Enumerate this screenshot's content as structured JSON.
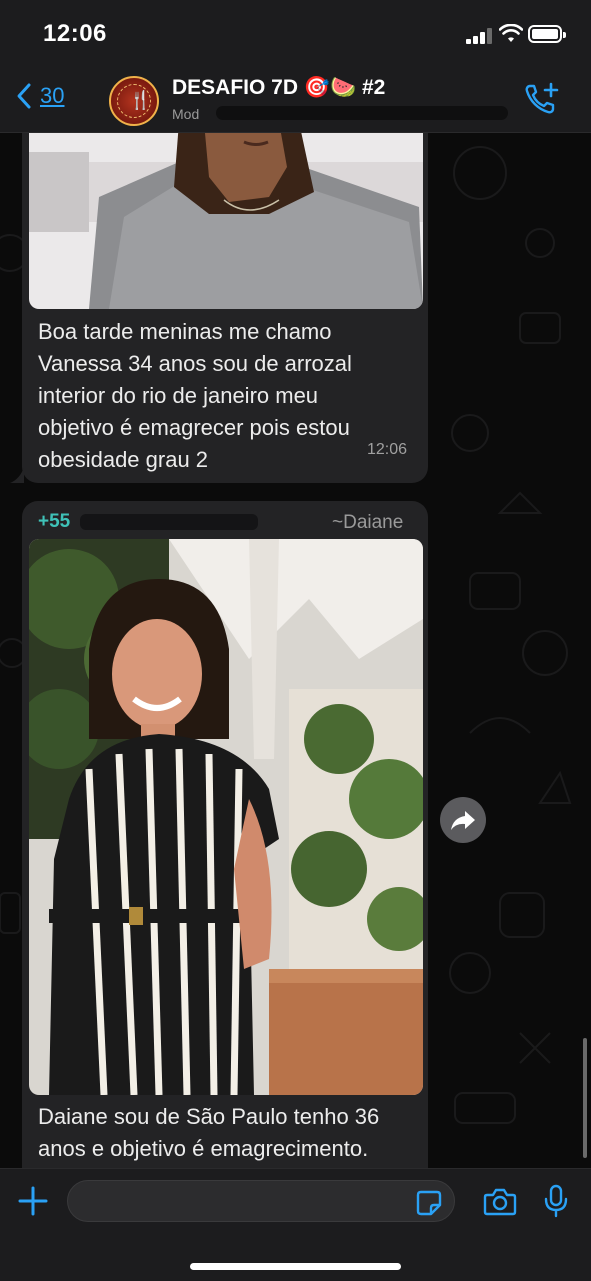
{
  "status_bar": {
    "time": "12:06"
  },
  "header": {
    "back_count": "30",
    "title": "DESAFIO 7D 🎯🍉 #2",
    "subtitle": "Mod",
    "avatar_text": "DICAS E RECEITAS DA RENATA"
  },
  "messages": [
    {
      "type": "image_with_caption",
      "caption": "Boa tarde meninas me chamo Vanessa 34 anos sou de arrozal interior do rio de janeiro meu objetivo é emagrecer pois estou obesidade grau 2",
      "caption_lines": [
        "Boa tarde meninas me chamo",
        "Vanessa 34 anos sou de arrozal",
        "interior do rio de janeiro meu",
        "objetivo é emagrecer pois estou",
        "obesidade grau 2"
      ],
      "time": "12:06"
    },
    {
      "type": "image_with_caption",
      "sender_phone": "+55",
      "sender_name": "~Daiane",
      "caption_lines": [
        "Daiane sou de São Paulo tenho 36",
        "anos e objetivo é emagrecimento."
      ]
    }
  ],
  "icons": {
    "back": "chevron-left-icon",
    "call": "add-call-icon",
    "forward": "forward-icon",
    "attach": "plus-icon",
    "sticker": "sticker-icon",
    "camera": "camera-icon",
    "mic": "microphone-icon"
  },
  "colors": {
    "accent": "#2aa1f5",
    "sender": "#3fc2b8",
    "bubble": "#232325"
  }
}
